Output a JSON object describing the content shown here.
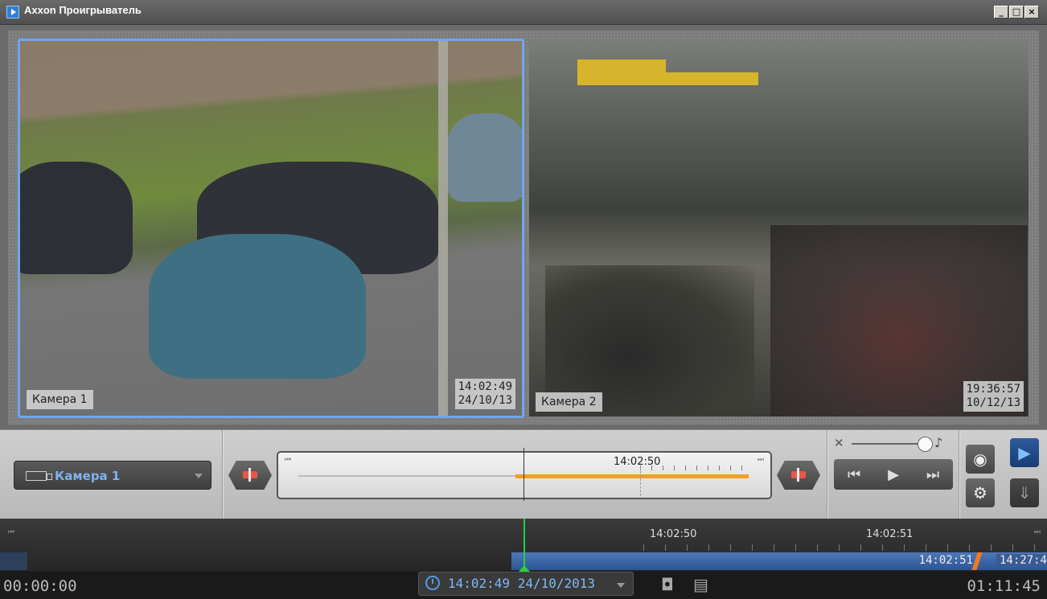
{
  "window": {
    "title": "Axxon Проигрыватель",
    "minimize": "_",
    "maximize": "□",
    "close": "×"
  },
  "cameras": [
    {
      "label": "Камера 1",
      "time": "14:02:49",
      "date": "24/10/13"
    },
    {
      "label": "Камера 2",
      "time": "19:36:57",
      "date": "10/12/13"
    }
  ],
  "controls": {
    "camera_select": {
      "value": "Камера 1",
      "icon": "camera-icon"
    },
    "track_time": "14:02:50",
    "icons": {
      "prev_mark": "marker-prev-icon",
      "next_mark": "marker-next-icon",
      "mute": "mute-icon",
      "speaker": "speaker-icon",
      "prev": "step-back-icon",
      "play": "play-icon",
      "next": "step-forward-icon",
      "eye": "eye-icon",
      "gear": "gear-icon",
      "playmode": "play-circle-icon",
      "export": "export-icon"
    },
    "volume_level": 0.85
  },
  "timeline": {
    "mark1": "14:02:50",
    "mark2": "14:02:51",
    "span_start": "14:02:51",
    "span_end": "14:27:4",
    "left_time": "00:00:00",
    "right_time": "01:11:45",
    "current": "14:02:49 24/10/2013",
    "icons": {
      "clock": "clock-icon",
      "snapshot": "camera-snapshot-icon",
      "print": "printer-icon"
    }
  },
  "colors": {
    "accent": "#6fa6ef",
    "progress": "#f0a020",
    "timeline_bar": "#4f78b8",
    "cursor": "#2ecc40"
  }
}
